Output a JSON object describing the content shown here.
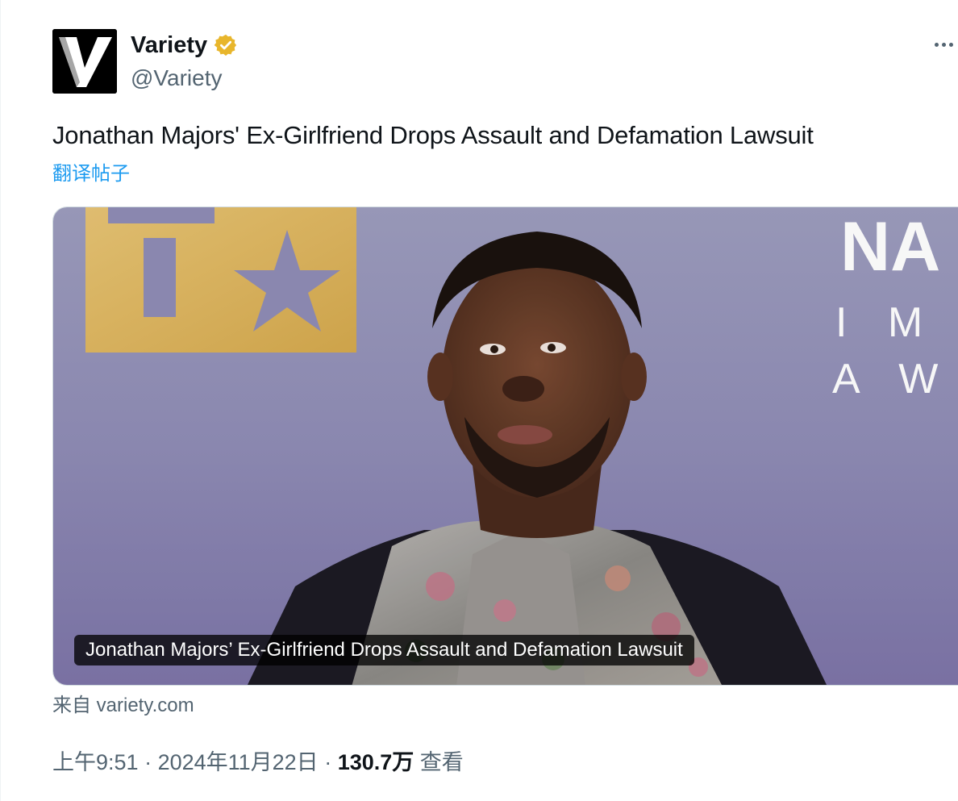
{
  "author": {
    "display_name": "Variety",
    "handle": "@Variety",
    "avatar_letter": "V",
    "verified_icon": "verified-badge-icon",
    "verified_color": "#e8b62c"
  },
  "more_icon": "more-horizontal-icon",
  "tweet": {
    "text": "Jonathan Majors' Ex-Girlfriend Drops Assault and Defamation Lawsuit",
    "translate_label": "翻译帖子"
  },
  "card": {
    "caption": "Jonathan Majors’ Ex-Girlfriend Drops Assault and Defamation Lawsuit",
    "backdrop_text": {
      "line1": "NA",
      "line2": "I M",
      "line3": "A W A"
    },
    "source": "来自 variety.com"
  },
  "meta": {
    "time": "上午9:51",
    "sep1": " · ",
    "date": "2024年11月22日",
    "sep2": " · ",
    "views_count": "130.7万",
    "views_label": " 查看"
  },
  "colors": {
    "link": "#1d9bf0",
    "secondary": "#536471",
    "primary": "#0f1419"
  }
}
